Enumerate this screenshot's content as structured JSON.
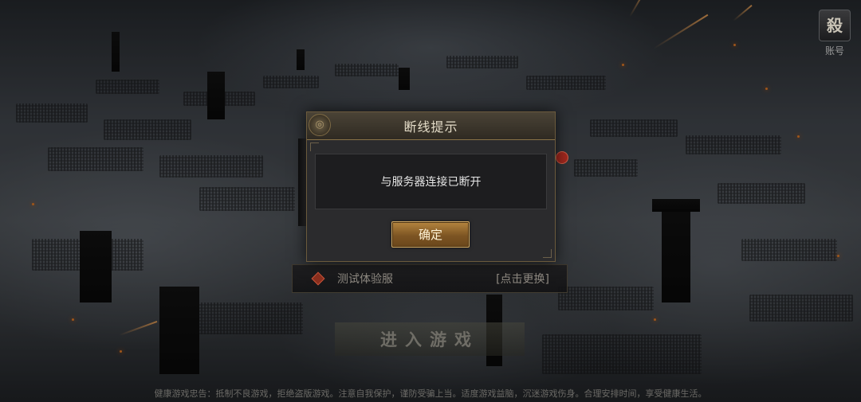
{
  "account": {
    "icon": "account-icon",
    "glyph": "殺",
    "label": "账号"
  },
  "dialog": {
    "title": "断线提示",
    "message": "与服务器连接已断开",
    "confirm_label": "确定"
  },
  "server": {
    "name": "测试体验服",
    "change_label": "[点击更换]"
  },
  "enter_game_label": "进入游戏",
  "notice": "健康游戏忠告：抵制不良游戏，拒绝盗版游戏。注意自我保护，谨防受骗上当。适度游戏益脑，沉迷游戏伤身。合理安排时间，享受健康生活。",
  "colors": {
    "dialog_border": "#6b5a3c",
    "confirm_button": "#7d5523",
    "server_marker": "#8a2f1e"
  }
}
